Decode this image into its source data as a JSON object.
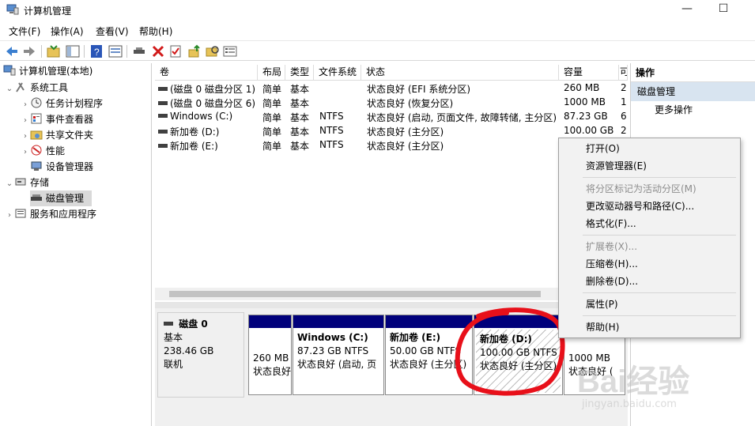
{
  "window": {
    "title": "计算机管理",
    "minimize_glyph": "—",
    "maximize_glyph": "☐"
  },
  "menu": [
    "文件(F)",
    "操作(A)",
    "查看(V)",
    "帮助(H)"
  ],
  "tree": {
    "root": "计算机管理(本地)",
    "system_tools": "系统工具",
    "task_scheduler": "任务计划程序",
    "event_viewer": "事件查看器",
    "shared_folders": "共享文件夹",
    "performance": "性能",
    "device_manager": "设备管理器",
    "storage": "存储",
    "disk_management": "磁盘管理",
    "services_apps": "服务和应用程序"
  },
  "volumes": {
    "headers": [
      "卷",
      "布局",
      "类型",
      "文件系统",
      "状态",
      "容量",
      "可"
    ],
    "rows": [
      {
        "name": "(磁盘 0 磁盘分区 1)",
        "layout": "简单",
        "type": "基本",
        "fs": "",
        "status": "状态良好 (EFI 系统分区)",
        "capacity": "260 MB",
        "free": "2"
      },
      {
        "name": "(磁盘 0 磁盘分区 6)",
        "layout": "简单",
        "type": "基本",
        "fs": "",
        "status": "状态良好 (恢复分区)",
        "capacity": "1000 MB",
        "free": "1"
      },
      {
        "name": "Windows (C:)",
        "layout": "简单",
        "type": "基本",
        "fs": "NTFS",
        "status": "状态良好 (启动, 页面文件, 故障转储, 主分区)",
        "capacity": "87.23 GB",
        "free": "6"
      },
      {
        "name": "新加卷 (D:)",
        "layout": "简单",
        "type": "基本",
        "fs": "NTFS",
        "status": "状态良好 (主分区)",
        "capacity": "100.00 GB",
        "free": "2"
      },
      {
        "name": "新加卷 (E:)",
        "layout": "简单",
        "type": "基本",
        "fs": "NTFS",
        "status": "状态良好 (主分区)",
        "capacity": "",
        "free": ""
      }
    ]
  },
  "disk": {
    "name": "磁盘 0",
    "type": "基本",
    "size": "238.46 GB",
    "state": "联机",
    "partitions": [
      {
        "title": "",
        "size": "260 MB",
        "status": "状态良好"
      },
      {
        "title": "Windows  (C:)",
        "size": "87.23 GB NTFS",
        "status": "状态良好 (启动, 页"
      },
      {
        "title": "新加卷  (E:)",
        "size": "50.00 GB NTFS",
        "status": "状态良好 (主分区)"
      },
      {
        "title": "新加卷  (D:)",
        "size": "100.00 GB NTFS",
        "status": "状态良好 (主分区)"
      },
      {
        "title": "",
        "size": "1000 MB",
        "status": "状态良好 ("
      }
    ]
  },
  "actions": {
    "header": "操作",
    "section": "磁盘管理",
    "more": "更多操作"
  },
  "context_menu": {
    "items": [
      {
        "label": "打开(O)",
        "enabled": true
      },
      {
        "label": "资源管理器(E)",
        "enabled": true
      },
      {
        "label": "将分区标记为活动分区(M)",
        "enabled": false
      },
      {
        "label": "更改驱动器号和路径(C)...",
        "enabled": true
      },
      {
        "label": "格式化(F)...",
        "enabled": true
      },
      {
        "label": "扩展卷(X)...",
        "enabled": false
      },
      {
        "label": "压缩卷(H)...",
        "enabled": true
      },
      {
        "label": "删除卷(D)...",
        "enabled": true
      },
      {
        "label": "属性(P)",
        "enabled": true
      },
      {
        "label": "帮助(H)",
        "enabled": true
      }
    ]
  },
  "watermark": {
    "brand": "Bai经验",
    "url": "jingyan.baidu.com"
  },
  "colors": {
    "partition_bar": "#00007b",
    "selection": "#d8e4f0",
    "annotation": "#e8101a"
  }
}
